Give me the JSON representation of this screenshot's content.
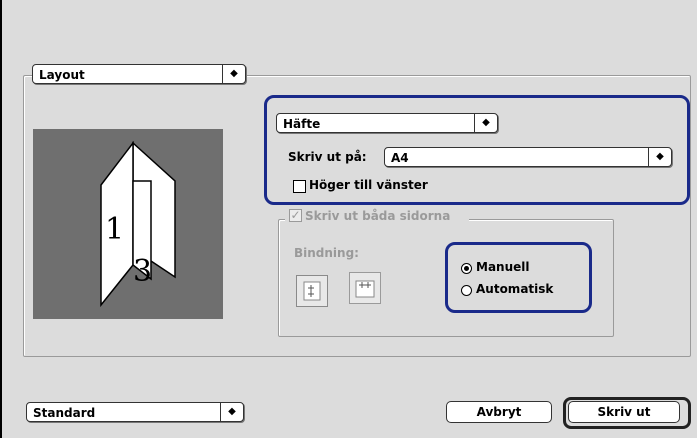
{
  "section_popup": {
    "value": "Layout"
  },
  "layout_popup": {
    "value": "Häfte"
  },
  "print_on": {
    "label": "Skriv ut på:",
    "value": "A4"
  },
  "right_to_left": {
    "label": "Höger till vänster",
    "checked": false
  },
  "duplex": {
    "label": "Skriv ut båda sidorna",
    "checked": true,
    "enabled": false
  },
  "binding": {
    "label": "Bindning:"
  },
  "mode": {
    "manual_label": "Manuell",
    "automatic_label": "Automatisk",
    "selected": "Manuell"
  },
  "preview": {
    "page_front": "1",
    "page_back": "3"
  },
  "preset_popup": {
    "value": "Standard"
  },
  "buttons": {
    "cancel": "Avbryt",
    "print": "Skriv ut"
  },
  "colors": {
    "highlight": "#1a2a8a",
    "window": "#dcdcdc",
    "preview_bg": "#6f6f6f"
  }
}
